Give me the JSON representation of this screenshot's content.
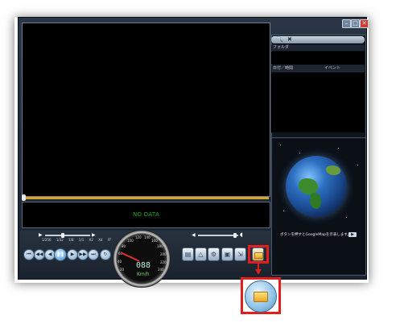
{
  "window": {
    "minimize_icon": "minimize-icon",
    "maximize_icon": "maximize-icon",
    "close_icon": "close-icon"
  },
  "video": {
    "no_data_text": "NO DATA"
  },
  "playback": {
    "speed_labels": [
      "1/250",
      "1/32",
      "1/8",
      "1/1",
      "X2",
      "X4",
      "FF"
    ],
    "buttons": [
      "skip-start-icon",
      "rewind-icon",
      "step-back-icon",
      "pause-icon",
      "step-forward-icon",
      "fast-forward-icon",
      "skip-end-icon",
      "repeat-icon"
    ]
  },
  "speedometer": {
    "digits": "088",
    "unit": "Km/h",
    "scale": [
      "20",
      "40",
      "60",
      "80",
      "100",
      "120",
      "140",
      "160",
      "180",
      "200",
      "220",
      "240"
    ]
  },
  "tools": [
    "fit-icon",
    "map-icon",
    "settings-icon",
    "save-icon",
    "export-icon",
    "folder-open-icon"
  ],
  "right_panel": {
    "folder_label": "フォルダ",
    "columns": {
      "datetime": "日付／時間",
      "event": "イベント"
    }
  },
  "map_panel": {
    "hint": "ボタンを押すとGoogleMapを示表します。",
    "button_icon": "play-icon"
  },
  "callout": {
    "highlighted": "folder-open-button"
  },
  "colors": {
    "highlight": "#e21e1e",
    "seek": "#d9a52a",
    "nodata_text": "#22b022"
  }
}
